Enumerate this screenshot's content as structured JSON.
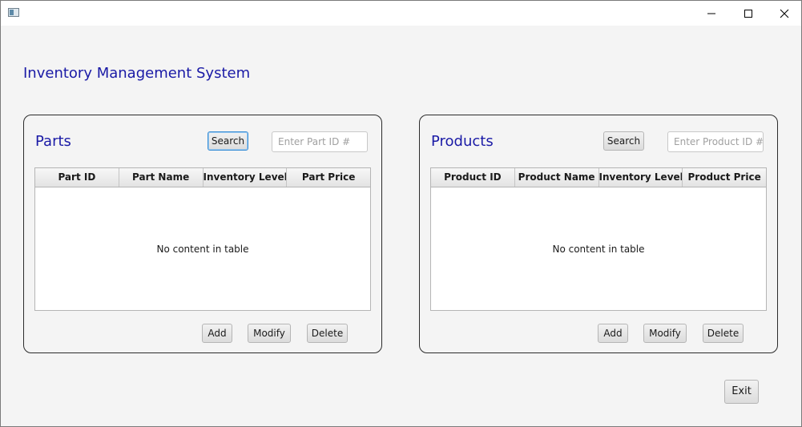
{
  "window": {
    "controls": {
      "minimize_icon": "minimize-icon",
      "maximize_icon": "maximize-icon",
      "close_icon": "close-icon"
    }
  },
  "app": {
    "title": "Inventory Management System",
    "title_color": "#1a1aa6"
  },
  "parts": {
    "title": "Parts",
    "search_label": "Search",
    "search_placeholder": "Enter Part ID #",
    "columns": [
      "Part ID",
      "Part Name",
      "Inventory Level",
      "Part Price"
    ],
    "rows": [],
    "empty_message": "No content in table",
    "add_label": "Add",
    "modify_label": "Modify",
    "delete_label": "Delete"
  },
  "products": {
    "title": "Products",
    "search_label": "Search",
    "search_placeholder": "Enter Product ID #",
    "columns": [
      "Product ID",
      "Product Name",
      "Inventory Level",
      "Product Price"
    ],
    "rows": [],
    "empty_message": "No content in table",
    "add_label": "Add",
    "modify_label": "Modify",
    "delete_label": "Delete"
  },
  "exit_label": "Exit"
}
